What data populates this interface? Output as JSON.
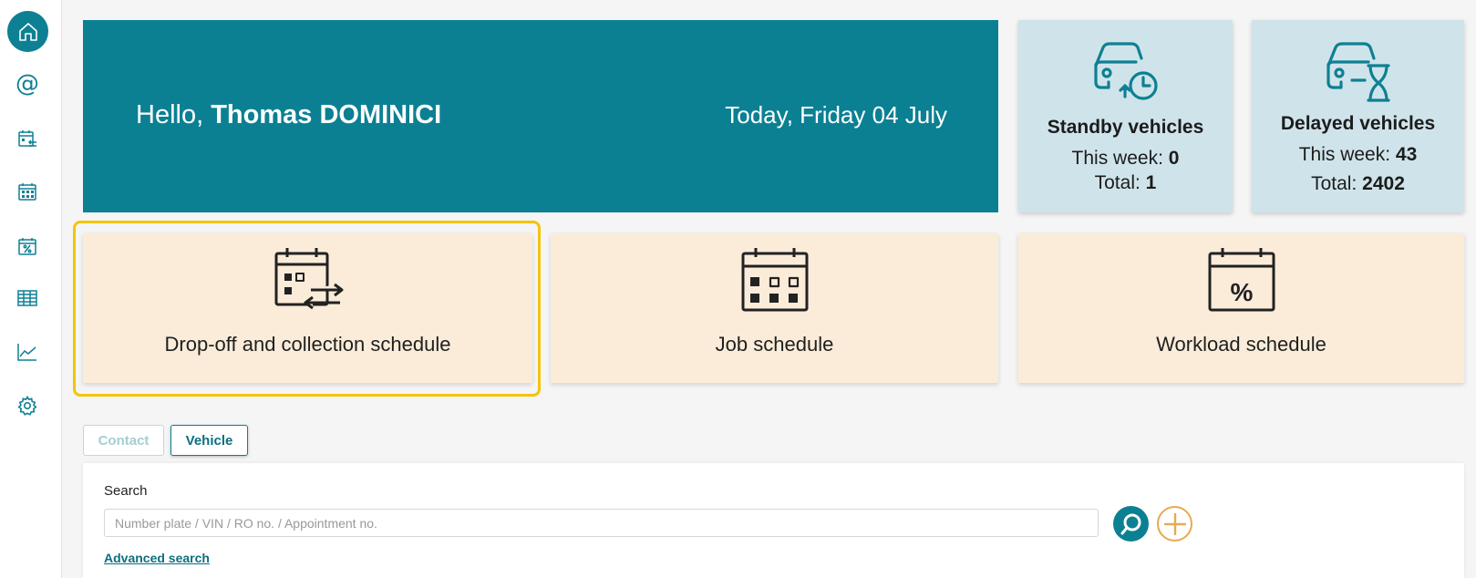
{
  "sidebar": {
    "items": [
      {
        "icon": "home-icon"
      },
      {
        "icon": "at-icon",
        "glyph": "@"
      },
      {
        "icon": "calendar-list-icon"
      },
      {
        "icon": "calendar-grid-icon"
      },
      {
        "icon": "calendar-percent-icon"
      },
      {
        "icon": "table-icon"
      },
      {
        "icon": "line-chart-icon"
      },
      {
        "icon": "gear-icon"
      }
    ]
  },
  "welcome": {
    "greeting": "Hello,",
    "user_name": "Thomas DOMINICI",
    "date": "Today, Friday 04 July"
  },
  "stats": {
    "standby": {
      "title": "Standby vehicles",
      "week_label": "This week:",
      "week_value": "0",
      "total_label": "Total:",
      "total_value": "1"
    },
    "delayed": {
      "title": "Delayed vehicles",
      "week_label": "This week:",
      "week_value": "43",
      "total_label": "Total:",
      "total_value": "2402"
    }
  },
  "schedules": [
    {
      "label": "Drop-off and collection schedule",
      "icon": "calendar-swap-icon"
    },
    {
      "label": "Job schedule",
      "icon": "calendar-grid-icon"
    },
    {
      "label": "Workload schedule",
      "icon": "calendar-percent-icon"
    }
  ],
  "tabs": {
    "contact": "Contact",
    "vehicle": "Vehicle"
  },
  "search": {
    "label": "Search",
    "placeholder": "Number plate / VIN / RO no. / Appointment no.",
    "advanced_link": "Advanced search"
  },
  "colors": {
    "primary": "#0b8093",
    "stat_bg": "#cfe4ea",
    "card_bg": "#faecd9",
    "highlight": "#f2c40c",
    "add_accent": "#e6aa54"
  }
}
